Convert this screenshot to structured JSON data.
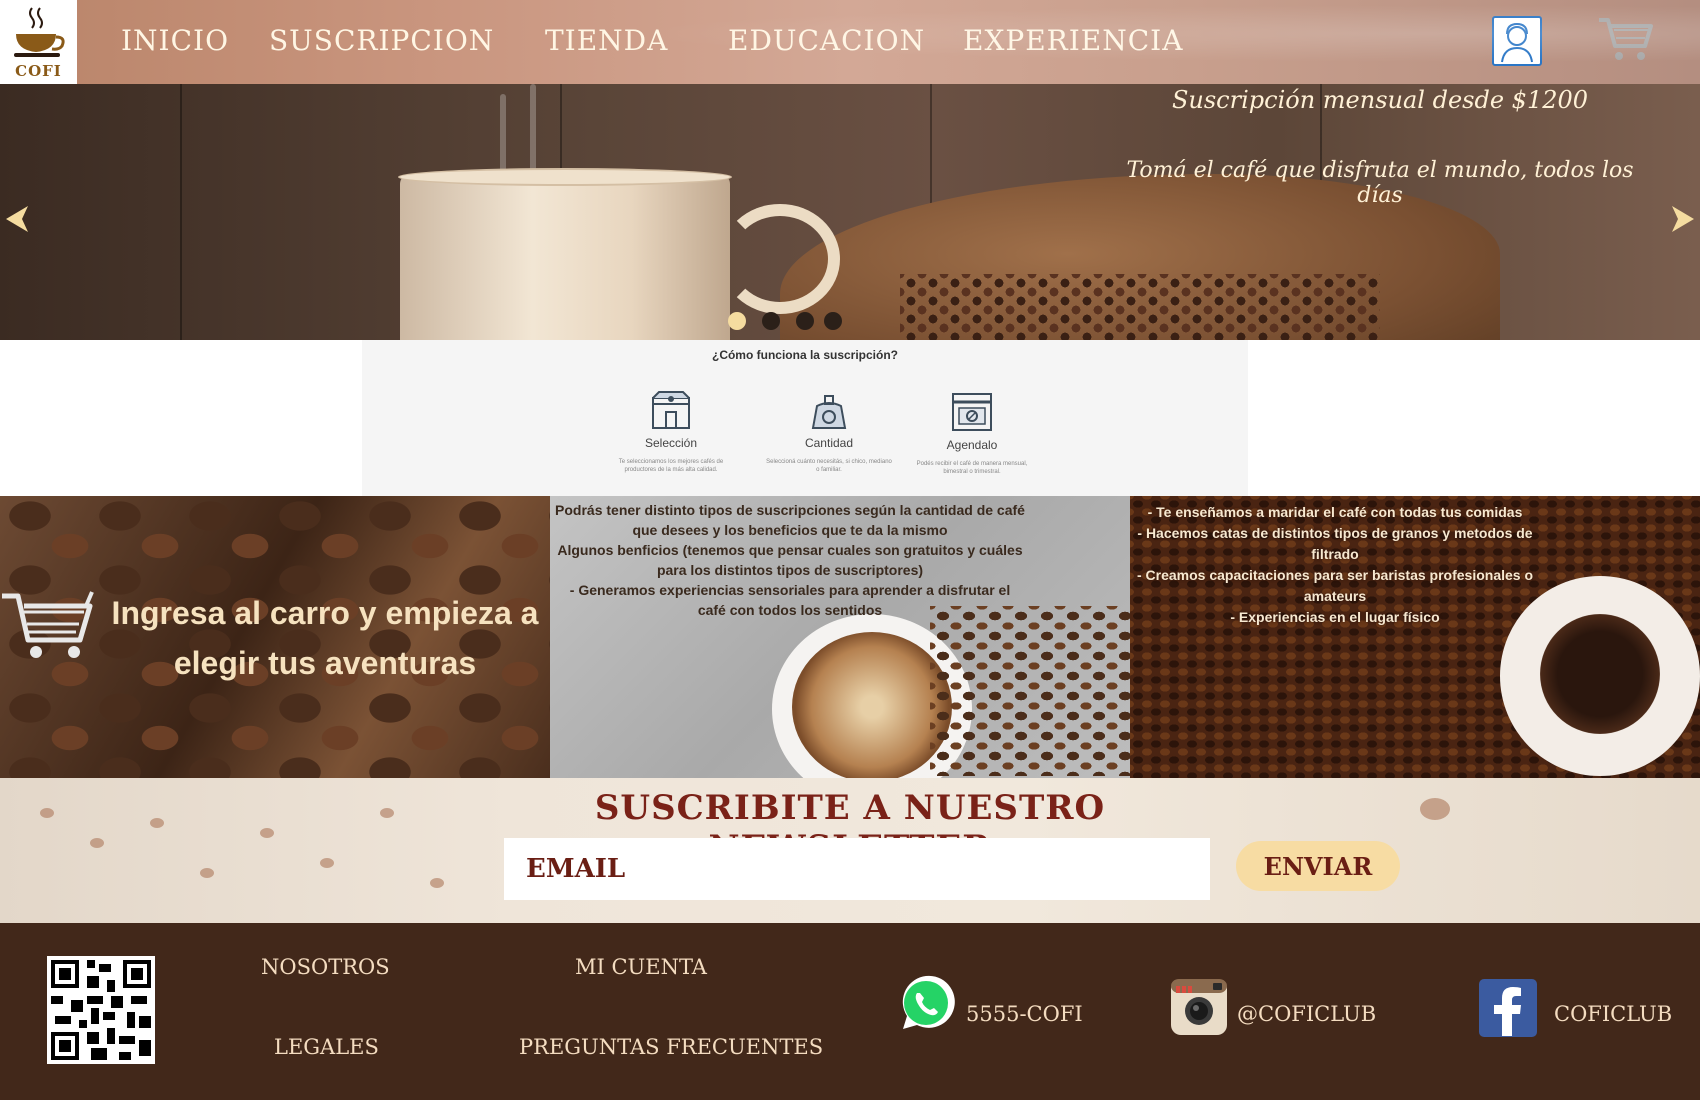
{
  "brand": {
    "name": "COFI"
  },
  "nav": {
    "items": [
      {
        "label": "INICIO"
      },
      {
        "label": "SUSCRIPCION"
      },
      {
        "label": "TIENDA"
      },
      {
        "label": "EDUCACION"
      },
      {
        "label": "EXPERIENCIA"
      }
    ],
    "icons": [
      "user-icon",
      "cart-icon"
    ]
  },
  "hero": {
    "promo_line_1": "Suscripción mensual desde $1200",
    "promo_line_2": "Tomá el café que disfruta el mundo, todos los días",
    "slides_total": 4,
    "active_slide": 1
  },
  "how_it_works": {
    "title": "¿Cómo funciona la suscripción?",
    "steps": [
      {
        "title": "Selección",
        "description": "Te seleccionamos los mejores cafés de productores de la más alta calidad.",
        "icon": "store-icon"
      },
      {
        "title": "Cantidad",
        "description": "Seleccioná cuánto necesitás, si chico, mediano o familiar.",
        "icon": "scale-icon"
      },
      {
        "title": "Agendalo",
        "description": "Podés recibir el café de manera mensual, bimestral o trimestral.",
        "icon": "calendar-icon"
      }
    ]
  },
  "panels": {
    "cart": {
      "title": "Ingresa al carro y empieza a elegir tus aventuras"
    },
    "info": {
      "lines": [
        "Podrás tener distinto tipos de suscripciones según la cantidad de café que desees y los beneficios que te da la mismo",
        "Algunos benficios (tenemos que pensar cuales son gratuitos y cuáles para los distintos tipos de suscriptores)",
        "- Generamos experiencias sensoriales para aprender a disfrutar el café con todos los sentidos"
      ]
    },
    "experience": {
      "lines": [
        "- Te enseñamos a maridar el café con todas tus comidas",
        "- Hacemos catas de distintos tipos de granos y metodos de filtrado",
        "- Creamos capacitaciones para ser baristas profesionales o amateurs",
        "- Experiencias en el lugar físico"
      ]
    }
  },
  "newsletter": {
    "title": "SUSCRIBITE A NUESTRO NEWSLETTER",
    "email_placeholder": "EMAIL",
    "send_label": "ENVIAR"
  },
  "footer": {
    "links": [
      {
        "label": "NOSOTROS"
      },
      {
        "label": "MI CUENTA"
      },
      {
        "label": "LEGALES"
      },
      {
        "label": "PREGUNTAS FRECUENTES"
      }
    ],
    "social": [
      {
        "icon": "whatsapp-icon",
        "text": "5555-COFI",
        "color": "#25d366"
      },
      {
        "icon": "instagram-icon",
        "text": "@COFICLUB",
        "color": "#8a6a4e"
      },
      {
        "icon": "facebook-icon",
        "text": "COFICLUB",
        "color": "#3b5ba0"
      }
    ]
  },
  "colors": {
    "nav_text": "#fff6e4",
    "accent_red": "#7a2218",
    "button_bg": "#f7dca3",
    "footer_bg": "#42281a"
  }
}
